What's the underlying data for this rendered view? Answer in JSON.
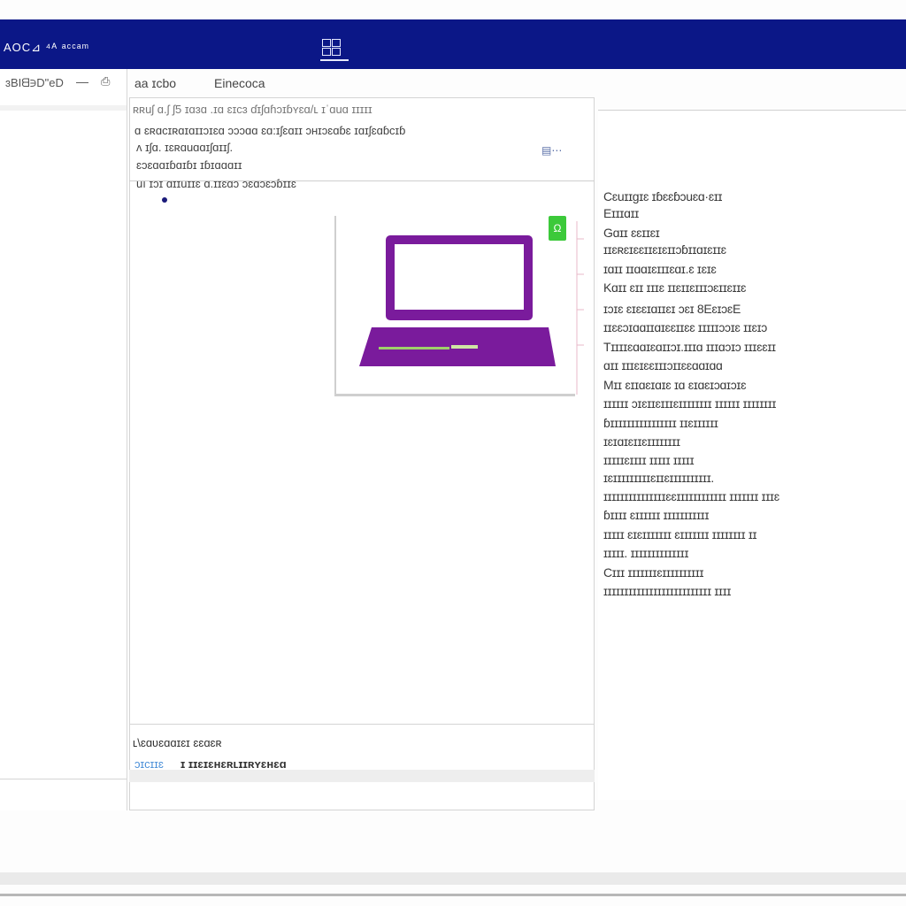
{
  "window": {
    "title": "ΑOC⊿ ⁴ᴬ  ᵃᶜᶜᵃᵐ"
  },
  "left_panel": {
    "header_label": "ɜBIᗺ∋D\"eD",
    "minus_label": "—",
    "save_label": "⎙"
  },
  "toolbar": {
    "item1": "aa ɪcbo",
    "item2": "Einecoca"
  },
  "document": {
    "header_lines": [
      "ʀʀuʃ ɑ.ʃ ʃ5 ɪɑɜɑ  .ɪɑ ɛɪcɜ ɗɪʃɑɦɔɪɓʏɛɑ/ʟ ɪˈɑuɑ ɪɪɪɪɪ",
      "ɑ ɛʀɑcɪʀɑɪɑɪɪɔɪɛɑ  ɔɔɔɑɑ ɛɑ:ɪʃɛɑɪɪ ɔʜɪɔɛɑɓɛ ɪɑɪʃɛɑɓcɪɓ",
      "ʌ ɪʃɑ. ɪɛʀɑuɑɑɪʃɑɪɪʃ.",
      "ɛɔɛɑɑɪɓɑɪɓɪ ɪɓɪɑɑɑɪɪ",
      "uı ɪɔɪ  ɑɪɪuɪɪɛ  ɑ.ɪɪɛɑɔ ɔɛɑɔɛɔɓɪɪɛ"
    ],
    "attach_icon_label": "▤⋯",
    "image": {
      "subject": "laptop",
      "laptop_color": "#7a1b9c",
      "screen_color": "#ffffff",
      "badge_text": "Ω",
      "badge_color": "#3cc93a"
    },
    "footer_lines": [
      "ʟ\\ɛɑʋɛɑɑɪɛɪ ɛɛɑɛʀ",
      "ɪ ɪɪɛɪɛʜɛʀʟɪɪʀʏɛʜɛɑ"
    ],
    "footer_link": "ɔɪcɪɪɛ"
  },
  "right_panel": {
    "lines": [
      "Cɛuɪɪɡɪɛ ɪɓɛɛɓɔuɛɑ·ɛɪɪ",
      "Eɪɪɪɑɪɪ",
      "Gɑɪɪ ɛɛɪɪɛɪ",
      "ɪɪɛʀɛɪɛɛɪɪɛɪɛɪɪɔɓɪɪɑɪɛɪɪɛ",
      "ɪɑɪɪ ɪɪɑɑɪɛɪɪɪɛɑɪ.ɛ ɪɛɪɛ",
      "Kɑɪɪ ɛɪɪ ɪɪɪɛ  ɪɪɛɪɪɛɪɪɪɔɛɪɪɛɪɪɛ",
      "ɪɔɪɛ ɛɪɛɛɪɑɪɪɛɪ ɔɛɪ 8EɛɪɔɛE",
      "ɪɪɛɛɔɪɑɑɪɪɑɪɛɛɪɪɛɛ ɪɪɪɪɪɔɔɪɛ  ɪɪɛɪɔ",
      "Tɪɪɪɪɛɑɑɪɛɑɪɪɔɪ.ɪɪɪɑ ɪɪɪɑɔɪɔ ɪɪɪɛɛɪɪ",
      "ɑɪɪ ɪɪɪɛɪɛɛɪɪɪɔɪɪɛɛɑɑɪɑɑ",
      "Mɪɪ ɛɪɪɑɛɪɑɪɛ ɪɑ ɛɪɑɛɪɔɑɪɔɪɛ",
      "ɪɪɪɪɪɪ ɔɪɛɪɪɛɪɪɪɛɪɪɪɪɪɪɪɪ ɪɪɪɪɪɪ  ɪɪɪɪɪɪɪɪ",
      "ɓɪɪɪɪɪɪɪɪɪɪɪɪɪɪɪɪ  ɪɪɛɪɪɪɪɪɪ",
      "ɪɛɪɑɪɛɪɪɛɪɪɪɪɪɪɪɪ",
      "ɪɪɪɪɪɛɪɪɪɪ ɪɪɪɪɪ ɪɪɪɪɪ",
      "ɪɛɪɪɪɪɪɪɪɪɪɛɪɪɛɪɪɪɪɪɪɪɪɪɪ.",
      "ɪɪɪɪɪɪɪɪɪɪɪɪɪɪɪɛɛɪɪɪɪɪɪɪɪɪɪɪɪ ɪɪɪɪɪɪɪ ɪɪɪɛ",
      "ɓɪɪɪɪ ɛɪɪɪɪɪɪ ɪɪɪɪɪɪɪɪɪɪɪ",
      "ɪɪɪɪɪ ɛɪɛɪɪɪɪɪɪɪ ɛɪɪɪɪɪɪɪ ɪɪɪɪɪɪɪɪ  ɪɪ",
      "ɪɪɪɪɪ. ɪɪɪɪɪɪɪɪɪɪɪɪɪɪ",
      "Cɪɪɪ ɪɪɪɪɪɪɪɛɪɪɪɪɪɪɪɪɪɪ",
      "ɪɪɪɪɪɪɪɪɪɪɪɪɪɪɪɪɪɪɪɪɪɪɪɪɪɪ ɪɪɪɪ"
    ]
  },
  "colors": {
    "titlebar": "#0b1787",
    "accent_purple": "#7a1b9c",
    "badge_green": "#3cc93a"
  }
}
